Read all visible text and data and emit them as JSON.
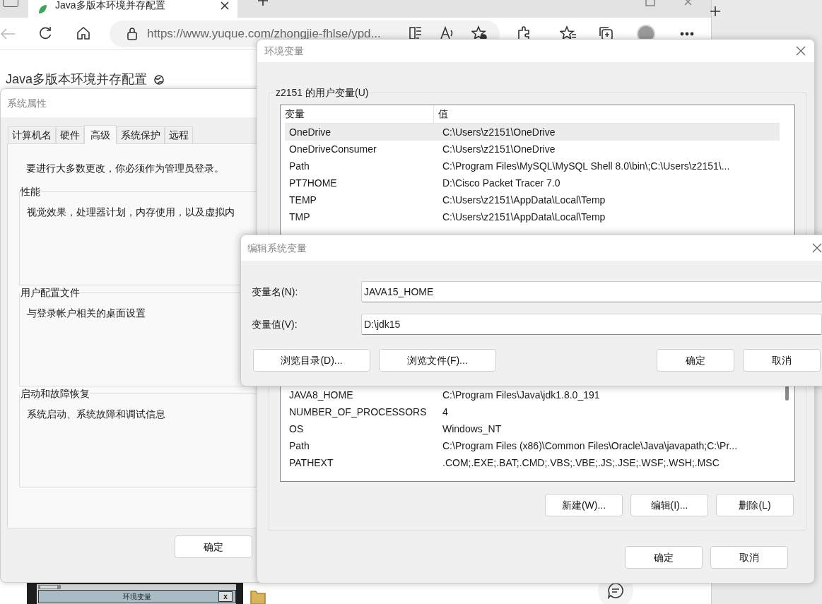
{
  "browser": {
    "tab_title": "Java多版本环境并存配置",
    "url": "https://www.yuque.com/zhongjie-fhlse/ypd...",
    "page_title": "Java多版本环境并存配置"
  },
  "article_image": {
    "title": "环境变量",
    "close": "x"
  },
  "system_properties": {
    "title": "系统属性",
    "tabs": [
      {
        "label": "计算机名",
        "selected": false
      },
      {
        "label": "硬件",
        "selected": false
      },
      {
        "label": "高级",
        "selected": true
      },
      {
        "label": "系统保护",
        "selected": false
      },
      {
        "label": "远程",
        "selected": false
      }
    ],
    "notice": "要进行大多数更改，你必须作为管理员登录。",
    "groups": [
      {
        "label": "性能",
        "description": "视觉效果，处理器计划，内存使用，以及虚拟内"
      },
      {
        "label": "用户配置文件",
        "description": "与登录帐户相关的桌面设置"
      },
      {
        "label": "启动和故障恢复",
        "description": "系统启动、系统故障和调试信息"
      }
    ],
    "ok_button": "确定"
  },
  "environment_variables": {
    "title": "环境变量",
    "user_group": "z2151 的用户变量(U)",
    "columns": [
      "变量",
      "值"
    ],
    "user_rows": [
      {
        "name": "OneDrive",
        "value": "C:\\Users\\z2151\\OneDrive",
        "selected": true
      },
      {
        "name": "OneDriveConsumer",
        "value": "C:\\Users\\z2151\\OneDrive",
        "selected": false
      },
      {
        "name": "Path",
        "value": "C:\\Program Files\\MySQL\\MySQL Shell 8.0\\bin\\;C:\\Users\\z2151\\...",
        "selected": false
      },
      {
        "name": "PT7HOME",
        "value": "D:\\Cisco Packet Tracer 7.0",
        "selected": false
      },
      {
        "name": "TEMP",
        "value": "C:\\Users\\z2151\\AppData\\Local\\Temp",
        "selected": false
      },
      {
        "name": "TMP",
        "value": "C:\\Users\\z2151\\AppData\\Local\\Temp",
        "selected": false
      }
    ],
    "system_rows": [
      {
        "name": "JAVA8_HOME",
        "value": "C:\\Program Files\\Java\\jdk1.8.0_191"
      },
      {
        "name": "NUMBER_OF_PROCESSORS",
        "value": "4"
      },
      {
        "name": "OS",
        "value": "Windows_NT"
      },
      {
        "name": "Path",
        "value": "C:\\Program Files (x86)\\Common Files\\Oracle\\Java\\javapath;C:\\Pr..."
      },
      {
        "name": "PATHEXT",
        "value": ".COM;.EXE;.BAT;.CMD;.VBS;.VBE;.JS;.JSE;.WSF;.WSH;.MSC"
      }
    ],
    "system_buttons": [
      "新建(W)...",
      "编辑(I)...",
      "删除(L)"
    ],
    "buttons": [
      "确定",
      "取消"
    ]
  },
  "edit_dialog": {
    "title": "编辑系统变量",
    "fields": [
      {
        "label": "变量名(N):",
        "value": "JAVA15_HOME"
      },
      {
        "label": "变量值(V):",
        "value": "D:\\jdk15"
      }
    ],
    "left_buttons": [
      "浏览目录(D)...",
      "浏览文件(F)..."
    ],
    "right_buttons": [
      "确定",
      "取消"
    ]
  }
}
